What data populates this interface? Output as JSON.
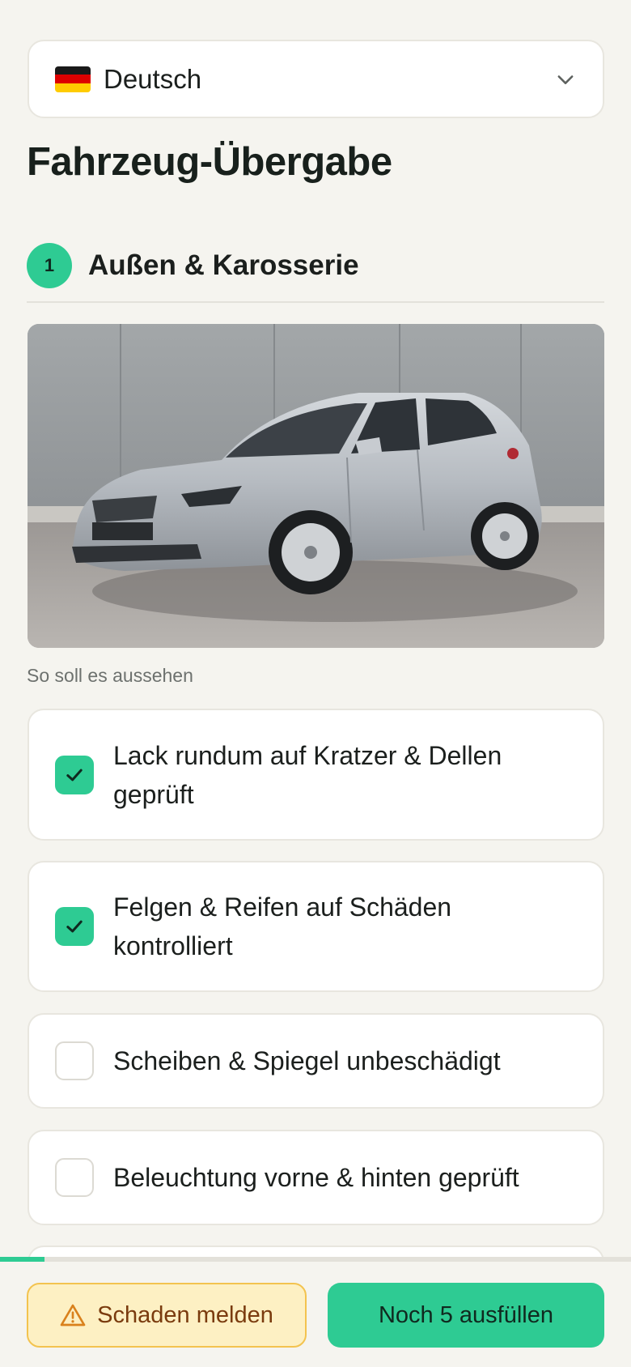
{
  "language_select": {
    "label": "Deutsch",
    "flag": "germany-flag-icon"
  },
  "page": {
    "title": "Fahrzeug-Übergabe"
  },
  "section": {
    "number": "1",
    "title": "Außen & Karosserie"
  },
  "reference": {
    "caption": "So soll es aussehen"
  },
  "checklist": [
    {
      "label": "Lack rundum auf Kratzer & Dellen geprüft",
      "checked": true
    },
    {
      "label": "Felgen & Reifen auf Schäden kontrolliert",
      "checked": true
    },
    {
      "label": "Scheiben & Spiegel unbeschädigt",
      "checked": false
    },
    {
      "label": "Beleuchtung vorne & hinten geprüft",
      "checked": false
    }
  ],
  "progress": {
    "fraction": 0.07
  },
  "footer": {
    "damage_label": "Schaden melden",
    "damage_icon": "warning-triangle-icon",
    "next_label": "Noch 5 ausfüllen"
  },
  "colors": {
    "accent": "#2ecb93",
    "background": "#f5f4ef",
    "warning_bg": "#fdf0c3",
    "warning_border": "#f3c34f",
    "warning_text": "#7a3b0e"
  }
}
